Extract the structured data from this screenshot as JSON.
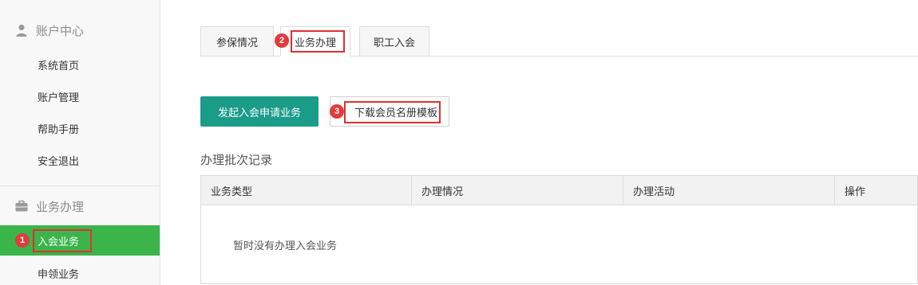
{
  "sidebar": {
    "account_section": {
      "icon": "user-icon",
      "label": "账户中心"
    },
    "account_items": [
      {
        "label": "系统首页"
      },
      {
        "label": "账户管理"
      },
      {
        "label": "帮助手册"
      },
      {
        "label": "安全退出"
      }
    ],
    "business_section": {
      "icon": "briefcase-icon",
      "label": "业务办理"
    },
    "business_items": [
      {
        "label": "入会业务",
        "active": true
      },
      {
        "label": "申领业务",
        "active": false
      }
    ]
  },
  "tabs": [
    {
      "label": "参保情况",
      "active": false
    },
    {
      "label": "业务办理",
      "active": true
    },
    {
      "label": "职工入会",
      "active": false
    }
  ],
  "actions": {
    "start_label": "发起入会申请业务",
    "download_label": "下载会员名册模板"
  },
  "records": {
    "title": "办理批次记录",
    "columns": [
      "业务类型",
      "办理情况",
      "办理活动",
      "操作"
    ],
    "empty_text": "暂时没有办理入会业务"
  },
  "annotations": {
    "markers": [
      "1",
      "2",
      "3"
    ],
    "color": "#e23b3b"
  },
  "colors": {
    "active_sidebar": "#3bb54a",
    "primary_button": "#1a9c89"
  }
}
